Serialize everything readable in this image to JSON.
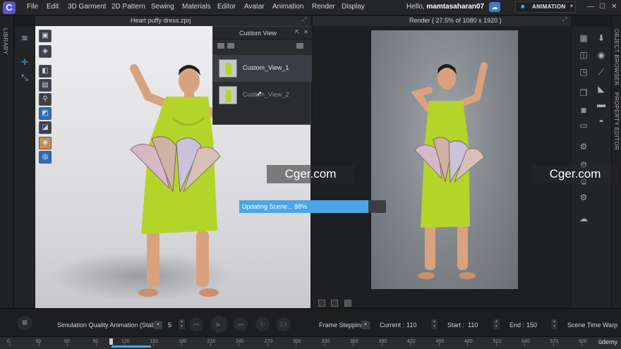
{
  "menubar": {
    "logo": "C",
    "items": [
      "File",
      "Edit",
      "3D Garment",
      "2D Pattern",
      "Sewing",
      "Materials",
      "Editor",
      "Avatar",
      "Animation",
      "Render",
      "Display"
    ],
    "greeting": "Hello,",
    "username": "mamtasaharan07",
    "mode": "ANIMATION",
    "window_controls": [
      "—",
      "☐",
      "✕"
    ]
  },
  "left_strip": {
    "label": "LIBRARY"
  },
  "viewport_2d": {
    "title": "Heart puffy dress.zprj"
  },
  "custom_view": {
    "title": "Custom View",
    "items": [
      {
        "label": "Custom_View_1"
      },
      {
        "label": "Custom_View_2"
      }
    ]
  },
  "render": {
    "title": "Render ( 27.5% of 1080 x 1920 )"
  },
  "right_strip": {
    "labels": [
      "OBJECT BROWSER",
      "PROPERTY EDITOR"
    ]
  },
  "watermark": "Cger.com",
  "progress": {
    "text": "Updating Scene... 88%",
    "value": 0.88
  },
  "bottom": {
    "sim_quality": "Simulation Quality Animation (Stable",
    "sim_value": "5",
    "frame_mode": "Frame Stepping",
    "current_label": "Current :",
    "current_value": "110",
    "start_label": "Start :",
    "start_value": "110",
    "end_label": "End :",
    "end_value": "150",
    "scene_time_warp": "Scene Time Warp",
    "play_controls": [
      "⏮",
      "▶",
      "⏭",
      "↻",
      "1X"
    ]
  },
  "timeline": {
    "ticks": [
      "0",
      "30",
      "60",
      "90",
      "120",
      "150",
      "180",
      "210",
      "240",
      "270",
      "300",
      "330",
      "360",
      "390",
      "420",
      "450",
      "480",
      "510",
      "540",
      "570",
      "600"
    ],
    "brand": "ûdemy"
  },
  "colors": {
    "accent": "#4aa6e6",
    "dress": "#b4d42a"
  }
}
